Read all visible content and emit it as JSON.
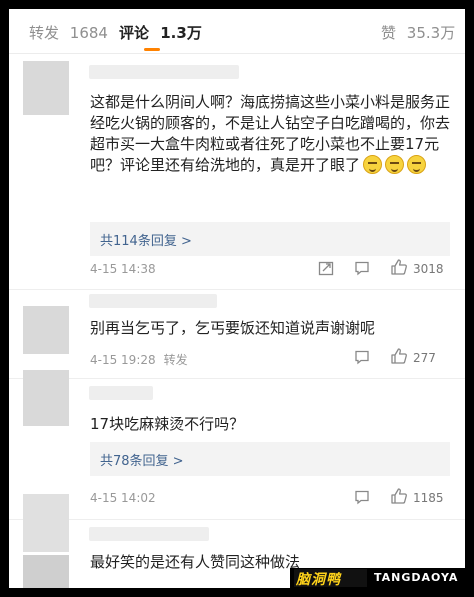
{
  "tabs": {
    "repost_label": "转发",
    "repost_count": "1684",
    "comment_label": "评论",
    "comment_count": "1.3万",
    "like_label": "赞",
    "like_count": "35.3万"
  },
  "comments": [
    {
      "text": "这都是什么阴间人啊？海底捞搞这些小菜小料是服务正经吃火锅的顾客的，不是让人钻空子白吃蹭喝的，你去超市买一大盒牛肉粒或者往死了吃小菜也不止要17元吧？评论里还有给洗地的，真是开了眼了",
      "emoji": [
        "doge",
        "doge",
        "doge"
      ],
      "replies": "共114条回复 >",
      "time": "4-15 14:38",
      "repost": "",
      "likes": "3018"
    },
    {
      "text": "别再当乞丐了，乞丐要饭还知道说声谢谢呢",
      "replies": "",
      "time": "4-15 19:28",
      "repost": "转发",
      "likes": "277"
    },
    {
      "text": "17块吃麻辣烫不行吗？",
      "replies": "共78条回复 >",
      "time": "4-15 14:02",
      "repost": "",
      "likes": "1185"
    },
    {
      "text": "最好笑的是还有人赞同这种做法",
      "replies": "",
      "time": "",
      "repost": "",
      "likes": ""
    }
  ],
  "icons": {
    "share": "share-icon",
    "comment": "comment-icon",
    "like": "thumbs-up-icon"
  },
  "watermark": {
    "cn": "脑洞鸭",
    "en": "TANGDAOYA"
  },
  "colors": {
    "accent": "#ff8200",
    "link": "#42648f"
  }
}
